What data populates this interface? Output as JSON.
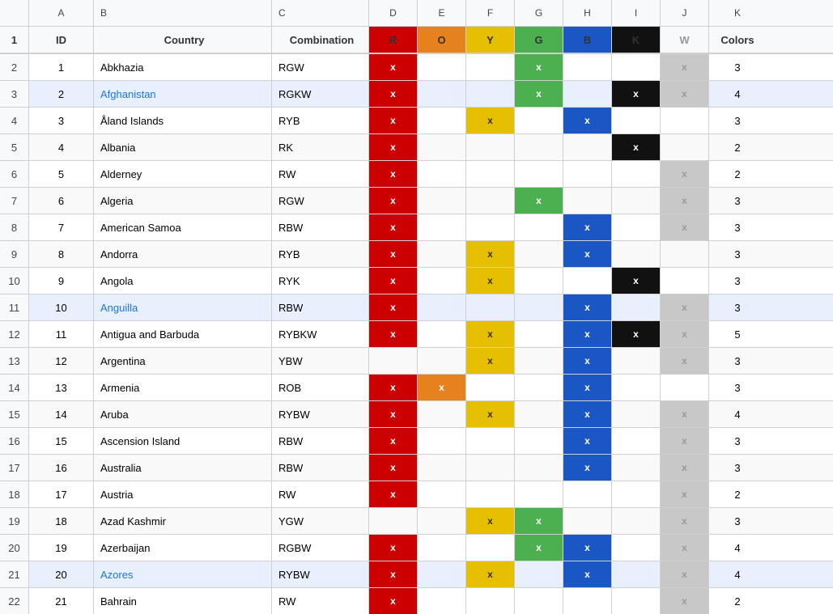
{
  "columns": {
    "letters": [
      "",
      "A",
      "B",
      "C",
      "D",
      "E",
      "F",
      "G",
      "H",
      "I",
      "J",
      "K"
    ],
    "headers": {
      "row_num": "",
      "a": "ID",
      "b": "Country",
      "c": "Combination",
      "d": "R",
      "e": "O",
      "f": "Y",
      "g": "G",
      "h": "B",
      "i": "K",
      "j": "W",
      "k": "Colors"
    }
  },
  "rows": [
    {
      "row": 2,
      "id": 1,
      "country": "Abkhazia",
      "combo": "RGW",
      "d": "x",
      "e": "",
      "f": "",
      "g": "x",
      "h": "",
      "i": "",
      "j": "x",
      "k": 3,
      "highlight": false
    },
    {
      "row": 3,
      "id": 2,
      "country": "Afghanistan",
      "combo": "RGKW",
      "d": "x",
      "e": "",
      "f": "",
      "g": "x",
      "h": "",
      "i": "x",
      "j": "x",
      "k": 4,
      "highlight": true
    },
    {
      "row": 4,
      "id": 3,
      "country": "Åland Islands",
      "combo": "RYB",
      "d": "x",
      "e": "",
      "f": "x",
      "g": "",
      "h": "x",
      "i": "",
      "j": "",
      "k": 3,
      "highlight": false
    },
    {
      "row": 5,
      "id": 4,
      "country": "Albania",
      "combo": "RK",
      "d": "x",
      "e": "",
      "f": "",
      "g": "",
      "h": "",
      "i": "x",
      "j": "",
      "k": 2,
      "highlight": false
    },
    {
      "row": 6,
      "id": 5,
      "country": "Alderney",
      "combo": "RW",
      "d": "x",
      "e": "",
      "f": "",
      "g": "",
      "h": "",
      "i": "",
      "j": "x",
      "k": 2,
      "highlight": false
    },
    {
      "row": 7,
      "id": 6,
      "country": "Algeria",
      "combo": "RGW",
      "d": "x",
      "e": "",
      "f": "",
      "g": "x",
      "h": "",
      "i": "",
      "j": "x",
      "k": 3,
      "highlight": false
    },
    {
      "row": 8,
      "id": 7,
      "country": "American Samoa",
      "combo": "RBW",
      "d": "x",
      "e": "",
      "f": "",
      "g": "",
      "h": "x",
      "i": "",
      "j": "x",
      "k": 3,
      "highlight": false
    },
    {
      "row": 9,
      "id": 8,
      "country": "Andorra",
      "combo": "RYB",
      "d": "x",
      "e": "",
      "f": "x",
      "g": "",
      "h": "x",
      "i": "",
      "j": "",
      "k": 3,
      "highlight": false
    },
    {
      "row": 10,
      "id": 9,
      "country": "Angola",
      "combo": "RYK",
      "d": "x",
      "e": "",
      "f": "x",
      "g": "",
      "h": "",
      "i": "x",
      "j": "",
      "k": 3,
      "highlight": false
    },
    {
      "row": 11,
      "id": 10,
      "country": "Anguilla",
      "combo": "RBW",
      "d": "x",
      "e": "",
      "f": "",
      "g": "",
      "h": "x",
      "i": "",
      "j": "x",
      "k": 3,
      "highlight": true
    },
    {
      "row": 12,
      "id": 11,
      "country": "Antigua and Barbuda",
      "combo": "RYBKW",
      "d": "x",
      "e": "",
      "f": "x",
      "g": "",
      "h": "x",
      "i": "x",
      "j": "x",
      "k": 5,
      "highlight": false
    },
    {
      "row": 13,
      "id": 12,
      "country": "Argentina",
      "combo": "YBW",
      "d": "",
      "e": "",
      "f": "x",
      "g": "",
      "h": "x",
      "i": "",
      "j": "x",
      "k": 3,
      "highlight": false
    },
    {
      "row": 14,
      "id": 13,
      "country": "Armenia",
      "combo": "ROB",
      "d": "x",
      "e": "x",
      "f": "",
      "g": "",
      "h": "x",
      "i": "",
      "j": "",
      "k": 3,
      "highlight": false
    },
    {
      "row": 15,
      "id": 14,
      "country": "Aruba",
      "combo": "RYBW",
      "d": "x",
      "e": "",
      "f": "x",
      "g": "",
      "h": "x",
      "i": "",
      "j": "x",
      "k": 4,
      "highlight": false
    },
    {
      "row": 16,
      "id": 15,
      "country": "Ascension Island",
      "combo": "RBW",
      "d": "x",
      "e": "",
      "f": "",
      "g": "",
      "h": "x",
      "i": "",
      "j": "x",
      "k": 3,
      "highlight": false
    },
    {
      "row": 17,
      "id": 16,
      "country": "Australia",
      "combo": "RBW",
      "d": "x",
      "e": "",
      "f": "",
      "g": "",
      "h": "x",
      "i": "",
      "j": "x",
      "k": 3,
      "highlight": false
    },
    {
      "row": 18,
      "id": 17,
      "country": "Austria",
      "combo": "RW",
      "d": "x",
      "e": "",
      "f": "",
      "g": "",
      "h": "",
      "i": "",
      "j": "x",
      "k": 2,
      "highlight": false
    },
    {
      "row": 19,
      "id": 18,
      "country": "Azad Kashmir",
      "combo": "YGW",
      "d": "",
      "e": "",
      "f": "x",
      "g": "x",
      "h": "",
      "i": "",
      "j": "x",
      "k": 3,
      "highlight": false
    },
    {
      "row": 20,
      "id": 19,
      "country": "Azerbaijan",
      "combo": "RGBW",
      "d": "x",
      "e": "",
      "f": "",
      "g": "x",
      "h": "x",
      "i": "",
      "j": "x",
      "k": 4,
      "highlight": false
    },
    {
      "row": 21,
      "id": 20,
      "country": "Azores",
      "combo": "RYBW",
      "d": "x",
      "e": "",
      "f": "x",
      "g": "",
      "h": "x",
      "i": "",
      "j": "x",
      "k": 4,
      "highlight": true
    },
    {
      "row": 22,
      "id": 21,
      "country": "Bahrain",
      "combo": "RW",
      "d": "x",
      "e": "",
      "f": "",
      "g": "",
      "h": "",
      "i": "",
      "j": "x",
      "k": 2,
      "highlight": false
    }
  ],
  "colors": {
    "r": "#cc0000",
    "o": "#e6821e",
    "y": "#e6c000",
    "g": "#4caf50",
    "b": "#1a56c4",
    "k": "#111111",
    "w_empty": "#c8c8c8",
    "highlight_row": "#e8f0fe"
  }
}
